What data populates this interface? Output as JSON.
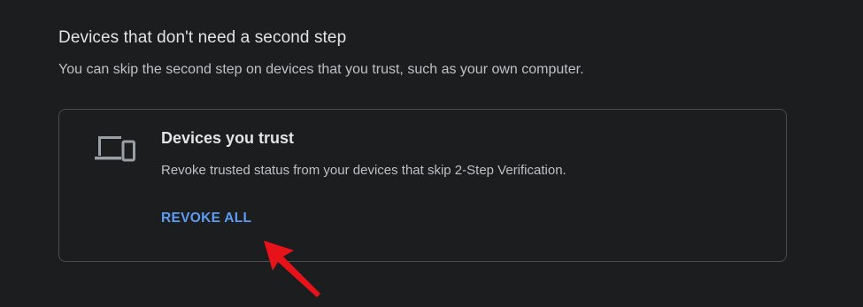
{
  "section": {
    "title": "Devices that don't need a second step",
    "description": "You can skip the second step on devices that you trust, such as your own computer."
  },
  "card": {
    "icon": "devices-icon",
    "title": "Devices you trust",
    "description": "Revoke trusted status from your devices that skip 2-Step Verification.",
    "action_label": "REVOKE ALL"
  },
  "annotation": {
    "icon": "red-arrow-icon",
    "color": "#e8131a"
  },
  "colors": {
    "background": "#1c1d1f",
    "accent": "#5e9cf0",
    "border": "#4a4c50"
  }
}
